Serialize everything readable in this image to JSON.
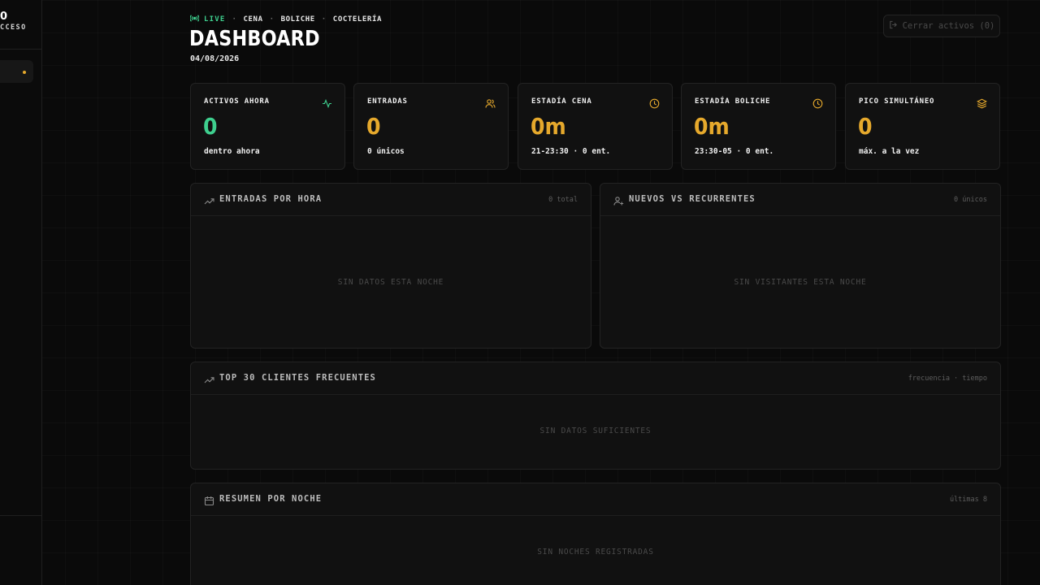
{
  "sidebar": {
    "brand_mark": "0",
    "brand_sub": "CCESO"
  },
  "header": {
    "live_label": "LIVE",
    "crumbs": [
      "CENA",
      "BOLICHE",
      "COCTELERÍA"
    ],
    "title": "DASHBOARD",
    "date": "04/08/2026",
    "close_button": "Cerrar activos (0)"
  },
  "kpis": [
    {
      "label": "ACTIVOS AHORA",
      "value": "0",
      "sub": "dentro ahora",
      "icon": "activity-icon",
      "color": "#3ecf8e"
    },
    {
      "label": "ENTRADAS",
      "value": "0",
      "sub": "0 únicos",
      "icon": "users-icon",
      "color": "#e6a92c"
    },
    {
      "label": "ESTADÍA CENA",
      "value": "0m",
      "sub": "21-23:30 · 0 ent.",
      "icon": "clock-icon",
      "color": "#e6a92c"
    },
    {
      "label": "ESTADÍA BOLICHE",
      "value": "0m",
      "sub": "23:30-05 · 0 ent.",
      "icon": "clock-icon",
      "color": "#e6a92c"
    },
    {
      "label": "PICO SIMULTÁNEO",
      "value": "0",
      "sub": "máx. a la vez",
      "icon": "layers-icon",
      "color": "#e6a92c"
    }
  ],
  "panels": {
    "entradas_hora": {
      "title": "ENTRADAS POR HORA",
      "meta": "0 total",
      "empty": "SIN DATOS ESTA NOCHE",
      "icon": "trending-up-icon"
    },
    "nuevos": {
      "title": "NUEVOS VS RECURRENTES",
      "meta": "0 únicos",
      "empty": "SIN VISITANTES ESTA NOCHE",
      "icon": "user-plus-icon"
    },
    "top": {
      "title": "TOP 30 CLIENTES FRECUENTES",
      "meta": "frecuencia · tiempo",
      "empty": "SIN DATOS SUFICIENTES",
      "icon": "trending-up-icon"
    },
    "resumen": {
      "title": "RESUMEN POR NOCHE",
      "meta": "últimas 8",
      "empty": "SIN NOCHES REGISTRADAS",
      "icon": "calendar-icon"
    }
  },
  "colors": {
    "accent_green": "#3ecf8e",
    "accent_amber": "#e6a92c"
  }
}
